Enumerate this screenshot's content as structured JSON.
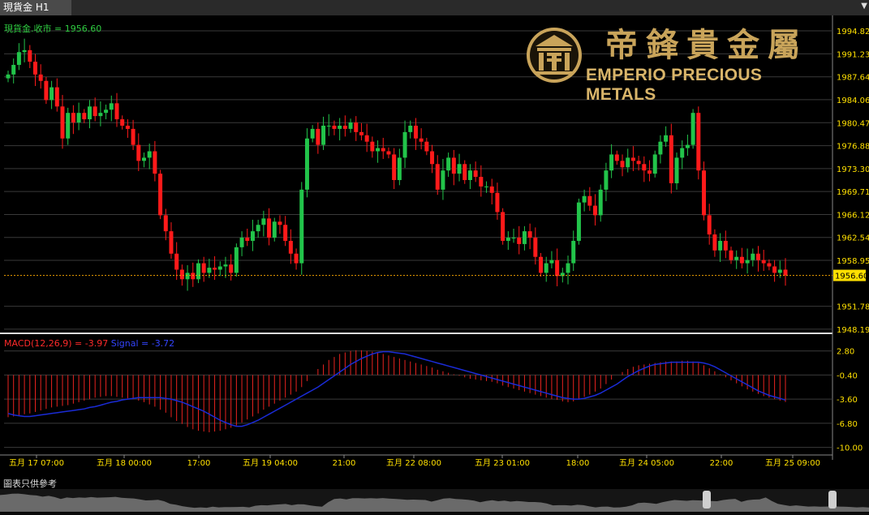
{
  "tab": {
    "title": "現貨金 H1"
  },
  "price_legend": "現貨金.收市 = 1956.60",
  "macd_legend": {
    "macd": "MACD(12,26,9) = -3.97",
    "signal": "Signal = -3.72"
  },
  "logo": {
    "chinese": "帝鋒貴金屬",
    "english": "EMPERIO PRECIOUS METALS"
  },
  "footer_note": "圖表只供參考",
  "colors": {
    "bull": "#22c44a",
    "bear": "#ff1a1a",
    "macd_hist": "#e8231f",
    "signal": "#1a2bd6",
    "grid": "#3a3a3a",
    "axis_text": "#ffe000",
    "current_price_bg": "#ffe000"
  },
  "chart_data": [
    {
      "type": "candlestick",
      "title": "現貨金 H1",
      "ylim": [
        1947.8,
        1996.6
      ],
      "y_ticks": [
        "1994.82",
        "1991.23",
        "1987.64",
        "1984.06",
        "1980.47",
        "1976.88",
        "1973.30",
        "1969.71",
        "1966.12",
        "1962.54",
        "1958.95",
        "1951.78",
        "1948.19"
      ],
      "current_price": 1956.6,
      "current_price_label": "1956.60",
      "x_ticks": [
        "五月 17 07:00",
        "五月 18 00:00",
        "17:00",
        "五月 19 04:00",
        "21:00",
        "五月 22 08:00",
        "五月 23 01:00",
        "18:00",
        "五月 24 05:00",
        "22:00",
        "五月 25 09:00"
      ],
      "close_series": [
        1988.0,
        1989.5,
        1991.5,
        1991.8,
        1990.0,
        1988.0,
        1987.0,
        1984.0,
        1986.0,
        1983.0,
        1978.0,
        1982.0,
        1980.5,
        1982.0,
        1981.0,
        1983.0,
        1981.5,
        1982.0,
        1982.5,
        1983.5,
        1981.0,
        1980.0,
        1979.5,
        1977.0,
        1974.5,
        1975.0,
        1976.0,
        1972.5,
        1966.0,
        1963.5,
        1960.0,
        1957.5,
        1956.0,
        1957.0,
        1956.0,
        1958.5,
        1957.0,
        1957.8,
        1957.5,
        1958.0,
        1958.3,
        1957.0,
        1961.0,
        1962.5,
        1962.0,
        1963.5,
        1964.5,
        1965.5,
        1962.5,
        1965.0,
        1964.5,
        1962.0,
        1960.0,
        1958.5,
        1970.0,
        1978.0,
        1979.5,
        1977.0,
        1980.0,
        1980.0,
        1979.5,
        1980.0,
        1979.5,
        1980.5,
        1979.0,
        1978.5,
        1977.5,
        1976.0,
        1976.5,
        1976.0,
        1975.5,
        1971.5,
        1975.0,
        1979.0,
        1980.0,
        1978.0,
        1977.5,
        1976.0,
        1974.0,
        1970.0,
        1973.0,
        1975.0,
        1972.5,
        1974.0,
        1971.5,
        1973.0,
        1972.0,
        1970.5,
        1970.5,
        1969.5,
        1966.5,
        1962.0,
        1962.5,
        1962.5,
        1961.5,
        1963.5,
        1962.5,
        1959.5,
        1957.0,
        1958.5,
        1959.0,
        1956.5,
        1957.0,
        1958.5,
        1962.0,
        1968.0,
        1969.0,
        1967.5,
        1966.0,
        1970.0,
        1973.0,
        1975.5,
        1974.5,
        1973.5,
        1975.0,
        1974.5,
        1974.0,
        1973.0,
        1972.5,
        1975.5,
        1977.5,
        1978.5,
        1971.0,
        1975.0,
        1976.5,
        1977.0,
        1982.0,
        1973.0,
        1966.0,
        1963.0,
        1960.5,
        1962.0,
        1960.5,
        1959.0,
        1959.5,
        1958.5,
        1959.0,
        1960.0,
        1959.0,
        1958.5,
        1958.0,
        1957.0,
        1957.5,
        1956.6
      ]
    },
    {
      "type": "macd",
      "title": "MACD(12,26,9) = -3.97",
      "ylim": [
        -10.8,
        4.6
      ],
      "y_ticks": [
        "2.80",
        "-0.40",
        "-3.60",
        "-6.80",
        "-10.00"
      ],
      "macd_values": [
        -6.0,
        -5.9,
        -5.8,
        -5.6,
        -5.5,
        -5.3,
        -5.1,
        -4.9,
        -4.7,
        -4.6,
        -4.5,
        -4.4,
        -4.2,
        -4.0,
        -3.8,
        -3.6,
        -3.4,
        -3.3,
        -3.2,
        -3.2,
        -3.3,
        -3.4,
        -3.5,
        -3.6,
        -3.8,
        -4.0,
        -4.3,
        -4.6,
        -5.0,
        -5.4,
        -6.0,
        -6.5,
        -6.9,
        -7.3,
        -7.6,
        -7.8,
        -7.9,
        -8.0,
        -7.9,
        -7.8,
        -7.6,
        -7.4,
        -7.1,
        -6.7,
        -6.3,
        -5.9,
        -5.5,
        -5.0,
        -4.6,
        -4.2,
        -3.8,
        -3.4,
        -3.0,
        -2.6,
        -2.0,
        -1.2,
        -0.4,
        0.4,
        1.0,
        1.6,
        2.0,
        2.4,
        2.6,
        2.8,
        2.9,
        2.9,
        2.8,
        2.7,
        2.6,
        2.4,
        2.2,
        2.0,
        1.8,
        1.6,
        1.4,
        1.2,
        1.0,
        0.8,
        0.6,
        0.3,
        0.1,
        -0.1,
        -0.3,
        -0.5,
        -0.7,
        -0.9,
        -1.0,
        -1.1,
        -1.2,
        -1.3,
        -1.5,
        -1.8,
        -2.0,
        -2.2,
        -2.4,
        -2.6,
        -2.8,
        -3.0,
        -3.2,
        -3.4,
        -3.6,
        -3.7,
        -3.9,
        -4.0,
        -3.9,
        -3.6,
        -3.3,
        -3.0,
        -2.6,
        -2.2,
        -1.6,
        -1.0,
        -0.4,
        0.0,
        0.4,
        0.7,
        0.9,
        1.0,
        1.1,
        1.2,
        1.3,
        1.4,
        1.4,
        1.4,
        1.5,
        1.5,
        1.4,
        1.2,
        0.9,
        0.5,
        0.1,
        -0.3,
        -0.7,
        -1.1,
        -1.5,
        -1.9,
        -2.3,
        -2.6,
        -2.9,
        -3.2,
        -3.4,
        -3.6,
        -3.8,
        -3.97
      ],
      "signal_values": [
        -5.5,
        -5.7,
        -5.8,
        -5.9,
        -5.9,
        -5.8,
        -5.7,
        -5.6,
        -5.5,
        -5.4,
        -5.3,
        -5.2,
        -5.1,
        -5.0,
        -4.9,
        -4.7,
        -4.6,
        -4.4,
        -4.2,
        -4.0,
        -3.9,
        -3.7,
        -3.6,
        -3.5,
        -3.4,
        -3.4,
        -3.4,
        -3.4,
        -3.4,
        -3.5,
        -3.6,
        -3.8,
        -4.0,
        -4.3,
        -4.6,
        -4.9,
        -5.2,
        -5.6,
        -6.0,
        -6.4,
        -6.7,
        -7.0,
        -7.2,
        -7.2,
        -7.0,
        -6.7,
        -6.4,
        -6.0,
        -5.6,
        -5.2,
        -4.8,
        -4.4,
        -4.0,
        -3.6,
        -3.2,
        -2.8,
        -2.4,
        -2.0,
        -1.5,
        -1.0,
        -0.5,
        0.0,
        0.5,
        1.0,
        1.4,
        1.8,
        2.1,
        2.4,
        2.6,
        2.7,
        2.7,
        2.6,
        2.5,
        2.4,
        2.2,
        2.0,
        1.8,
        1.6,
        1.4,
        1.2,
        1.0,
        0.8,
        0.6,
        0.4,
        0.2,
        0.0,
        -0.2,
        -0.4,
        -0.6,
        -0.8,
        -1.0,
        -1.2,
        -1.4,
        -1.6,
        -1.8,
        -2.0,
        -2.2,
        -2.4,
        -2.6,
        -2.8,
        -3.0,
        -3.2,
        -3.4,
        -3.5,
        -3.6,
        -3.6,
        -3.5,
        -3.3,
        -3.1,
        -2.8,
        -2.4,
        -2.0,
        -1.6,
        -1.1,
        -0.6,
        -0.2,
        0.2,
        0.5,
        0.8,
        1.0,
        1.1,
        1.2,
        1.3,
        1.3,
        1.3,
        1.3,
        1.3,
        1.3,
        1.2,
        1.0,
        0.7,
        0.3,
        -0.1,
        -0.5,
        -0.9,
        -1.3,
        -1.7,
        -2.1,
        -2.5,
        -2.8,
        -3.1,
        -3.3,
        -3.5,
        -3.72
      ]
    }
  ]
}
